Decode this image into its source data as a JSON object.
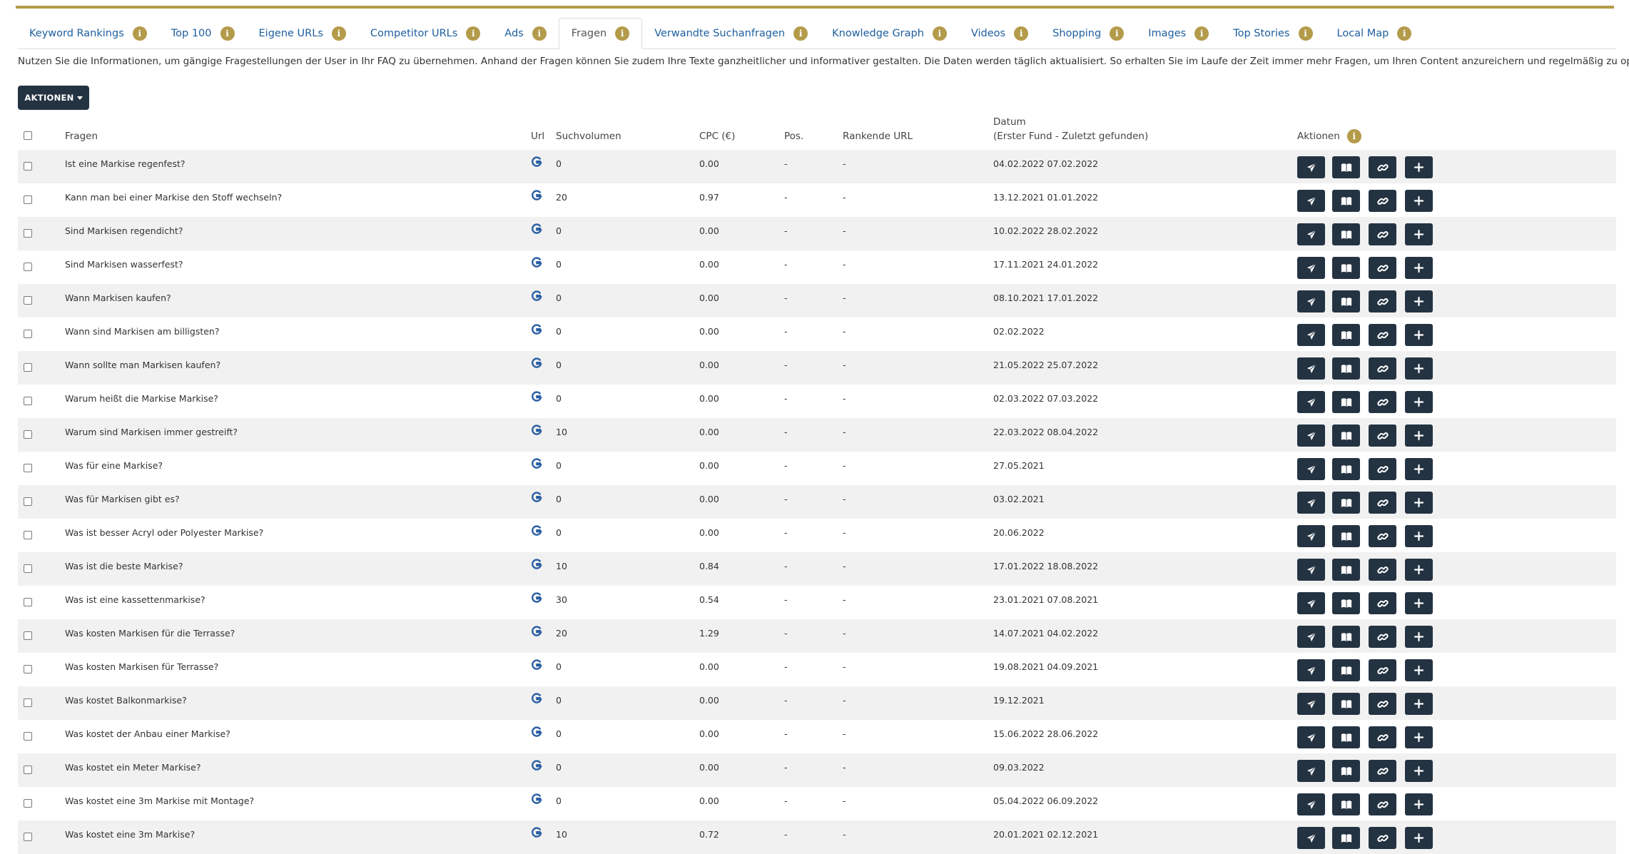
{
  "tabs": [
    {
      "label": "Keyword Rankings",
      "active": false
    },
    {
      "label": "Top 100",
      "active": false
    },
    {
      "label": "Eigene URLs",
      "active": false
    },
    {
      "label": "Competitor URLs",
      "active": false
    },
    {
      "label": "Ads",
      "active": false
    },
    {
      "label": "Fragen",
      "active": true
    },
    {
      "label": "Verwandte Suchanfragen",
      "active": false
    },
    {
      "label": "Knowledge Graph",
      "active": false
    },
    {
      "label": "Videos",
      "active": false
    },
    {
      "label": "Shopping",
      "active": false
    },
    {
      "label": "Images",
      "active": false
    },
    {
      "label": "Top Stories",
      "active": false
    },
    {
      "label": "Local Map",
      "active": false
    }
  ],
  "intro": "Nutzen Sie die Informationen, um gängige Fragestellungen der User in Ihr FAQ zu übernehmen. Anhand der Fragen können Sie zudem Ihre Texte ganzheitlicher und informativer gestalten. Die Daten werden täglich aktualisiert. So erhalten Sie im Laufe der Zeit immer mehr Fragen, um Ihren Content anzureichern und regelmäßig zu optimieren.",
  "actions_button": "AKTIONEN",
  "columns": {
    "question": "Fragen",
    "url": "Url",
    "volume": "Suchvolumen",
    "cpc": "CPC (€)",
    "pos": "Pos.",
    "ranking_url": "Rankende URL",
    "date_line1": "Datum",
    "date_line2": "(Erster Fund - Zuletzt gefunden)",
    "actions": "Aktionen"
  },
  "info_glyph": "i",
  "icons": {
    "url": "google-g-icon",
    "action_buttons": [
      "send-icon",
      "book-icon",
      "link-icon",
      "plus-icon"
    ],
    "header_info": "info-icon"
  },
  "colors": {
    "accent_gold": "#b39b4a",
    "button_dark": "#243342",
    "link_blue": "#1d5e9e",
    "row_stripe": "#f1f1f1"
  },
  "rows": [
    {
      "question": "Ist eine Markise regenfest?",
      "volume": "0",
      "cpc": "0.00",
      "pos": "-",
      "ranking_url": "-",
      "date": "04.02.2022 07.02.2022"
    },
    {
      "question": "Kann man bei einer Markise den Stoff wechseln?",
      "volume": "20",
      "cpc": "0.97",
      "pos": "-",
      "ranking_url": "-",
      "date": "13.12.2021 01.01.2022"
    },
    {
      "question": "Sind Markisen regendicht?",
      "volume": "0",
      "cpc": "0.00",
      "pos": "-",
      "ranking_url": "-",
      "date": "10.02.2022 28.02.2022"
    },
    {
      "question": "Sind Markisen wasserfest?",
      "volume": "0",
      "cpc": "0.00",
      "pos": "-",
      "ranking_url": "-",
      "date": "17.11.2021 24.01.2022"
    },
    {
      "question": "Wann Markisen kaufen?",
      "volume": "0",
      "cpc": "0.00",
      "pos": "-",
      "ranking_url": "-",
      "date": "08.10.2021 17.01.2022"
    },
    {
      "question": "Wann sind Markisen am billigsten?",
      "volume": "0",
      "cpc": "0.00",
      "pos": "-",
      "ranking_url": "-",
      "date": "02.02.2022"
    },
    {
      "question": "Wann sollte man Markisen kaufen?",
      "volume": "0",
      "cpc": "0.00",
      "pos": "-",
      "ranking_url": "-",
      "date": "21.05.2022 25.07.2022"
    },
    {
      "question": "Warum heißt die Markise Markise?",
      "volume": "0",
      "cpc": "0.00",
      "pos": "-",
      "ranking_url": "-",
      "date": "02.03.2022 07.03.2022"
    },
    {
      "question": "Warum sind Markisen immer gestreift?",
      "volume": "10",
      "cpc": "0.00",
      "pos": "-",
      "ranking_url": "-",
      "date": "22.03.2022 08.04.2022"
    },
    {
      "question": "Was für eine Markise?",
      "volume": "0",
      "cpc": "0.00",
      "pos": "-",
      "ranking_url": "-",
      "date": "27.05.2021"
    },
    {
      "question": "Was für Markisen gibt es?",
      "volume": "0",
      "cpc": "0.00",
      "pos": "-",
      "ranking_url": "-",
      "date": "03.02.2021"
    },
    {
      "question": "Was ist besser Acryl oder Polyester Markise?",
      "volume": "0",
      "cpc": "0.00",
      "pos": "-",
      "ranking_url": "-",
      "date": "20.06.2022"
    },
    {
      "question": "Was ist die beste Markise?",
      "volume": "10",
      "cpc": "0.84",
      "pos": "-",
      "ranking_url": "-",
      "date": "17.01.2022 18.08.2022"
    },
    {
      "question": "Was ist eine kassettenmarkise?",
      "volume": "30",
      "cpc": "0.54",
      "pos": "-",
      "ranking_url": "-",
      "date": "23.01.2021 07.08.2021"
    },
    {
      "question": "Was kosten Markisen für die Terrasse?",
      "volume": "20",
      "cpc": "1.29",
      "pos": "-",
      "ranking_url": "-",
      "date": "14.07.2021 04.02.2022"
    },
    {
      "question": "Was kosten Markisen für Terrasse?",
      "volume": "0",
      "cpc": "0.00",
      "pos": "-",
      "ranking_url": "-",
      "date": "19.08.2021 04.09.2021"
    },
    {
      "question": "Was kostet Balkonmarkise?",
      "volume": "0",
      "cpc": "0.00",
      "pos": "-",
      "ranking_url": "-",
      "date": "19.12.2021"
    },
    {
      "question": "Was kostet der Anbau einer Markise?",
      "volume": "0",
      "cpc": "0.00",
      "pos": "-",
      "ranking_url": "-",
      "date": "15.06.2022 28.06.2022"
    },
    {
      "question": "Was kostet ein Meter Markise?",
      "volume": "0",
      "cpc": "0.00",
      "pos": "-",
      "ranking_url": "-",
      "date": "09.03.2022"
    },
    {
      "question": "Was kostet eine 3m Markise mit Montage?",
      "volume": "0",
      "cpc": "0.00",
      "pos": "-",
      "ranking_url": "-",
      "date": "05.04.2022 06.09.2022"
    },
    {
      "question": "Was kostet eine 3m Markise?",
      "volume": "10",
      "cpc": "0.72",
      "pos": "-",
      "ranking_url": "-",
      "date": "20.01.2021 02.12.2021"
    }
  ]
}
